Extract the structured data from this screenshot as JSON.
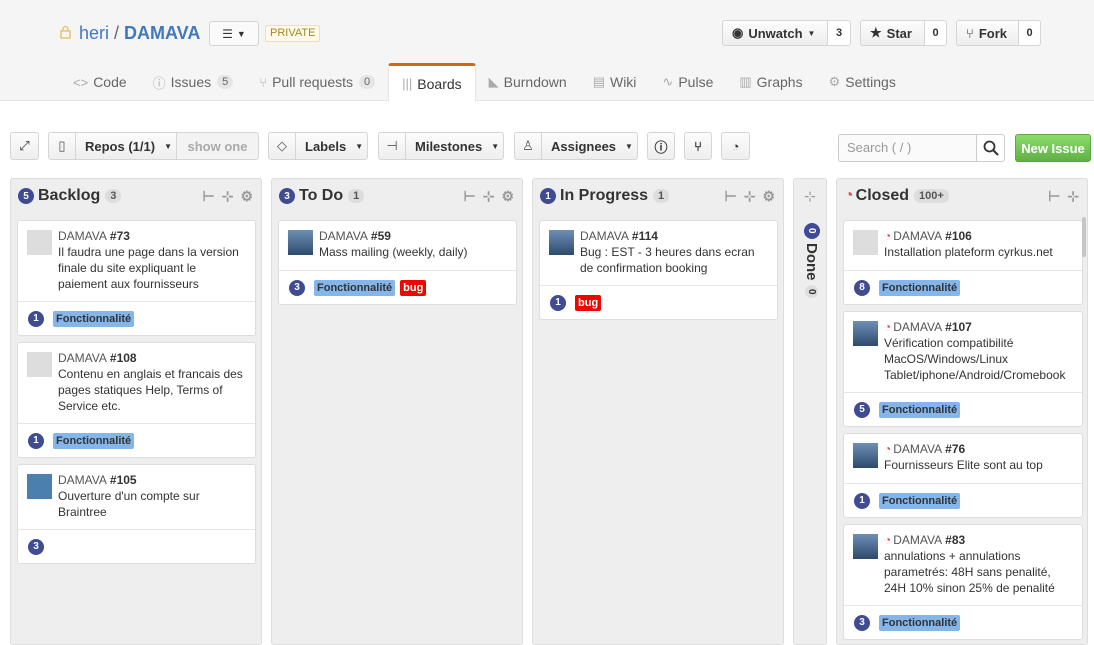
{
  "repo": {
    "owner": "heri",
    "name": "DAMAVA",
    "visibility": "PRIVATE",
    "list_icon": "list-icon"
  },
  "actions": {
    "watch_label": "Unwatch",
    "watch_count": "3",
    "star_label": "Star",
    "star_count": "0",
    "fork_label": "Fork",
    "fork_count": "0"
  },
  "nav": {
    "code": "Code",
    "issues": "Issues",
    "issues_count": "5",
    "pulls": "Pull requests",
    "pulls_count": "0",
    "boards": "Boards",
    "burndown": "Burndown",
    "wiki": "Wiki",
    "pulse": "Pulse",
    "graphs": "Graphs",
    "settings": "Settings"
  },
  "toolbar": {
    "repos": "Repos (1/1)",
    "show_one": "show one",
    "labels": "Labels",
    "milestones": "Milestones",
    "assignees": "Assignees",
    "search_placeholder": "Search ( / )",
    "new_issue": "New Issue"
  },
  "columns": {
    "backlog": {
      "num": "5",
      "title": "Backlog",
      "count": "3"
    },
    "todo": {
      "num": "3",
      "title": "To Do",
      "count": "1"
    },
    "inprogress": {
      "num": "1",
      "title": "In Progress",
      "count": "1"
    },
    "done": {
      "num": "0",
      "title": "Done",
      "count": "0"
    },
    "closed": {
      "title": "Closed",
      "count": "100+"
    }
  },
  "labels": {
    "feature": "Fonctionnalité",
    "bug": "bug"
  },
  "cards": {
    "c73": {
      "repo": "DAMAVA",
      "num": "#73",
      "title": "Il faudra une page dans la version finale du site expliquant le paiement aux fournisseurs",
      "badge": "1"
    },
    "c108": {
      "repo": "DAMAVA",
      "num": "#108",
      "title": "Contenu en anglais et francais des pages statiques Help, Terms of Service etc.",
      "badge": "1"
    },
    "c105": {
      "repo": "DAMAVA",
      "num": "#105",
      "title": "Ouverture d'un compte sur Braintree",
      "badge": "3"
    },
    "c59": {
      "repo": "DAMAVA",
      "num": "#59",
      "title": "Mass mailing (weekly, daily)",
      "badge": "3"
    },
    "c114": {
      "repo": "DAMAVA",
      "num": "#114",
      "title": "Bug : EST - 3 heures dans ecran de confirmation booking",
      "badge": "1"
    },
    "c106": {
      "repo": "DAMAVA",
      "num": "#106",
      "title": "Installation plateform cyrkus.net",
      "badge": "8"
    },
    "c107": {
      "repo": "DAMAVA",
      "num": "#107",
      "title": "Vérification compatibilité MacOS/Windows/Linux Tablet/iphone/Android/Cromebook",
      "badge": "5"
    },
    "c76": {
      "repo": "DAMAVA",
      "num": "#76",
      "title": "Fournisseurs Elite sont au top",
      "badge": "1"
    },
    "c83": {
      "repo": "DAMAVA",
      "num": "#83",
      "title": "annulations + annulations parametrés: 48H sans penalité, 24H 10% sinon 25% de penalité",
      "badge": "3"
    }
  }
}
